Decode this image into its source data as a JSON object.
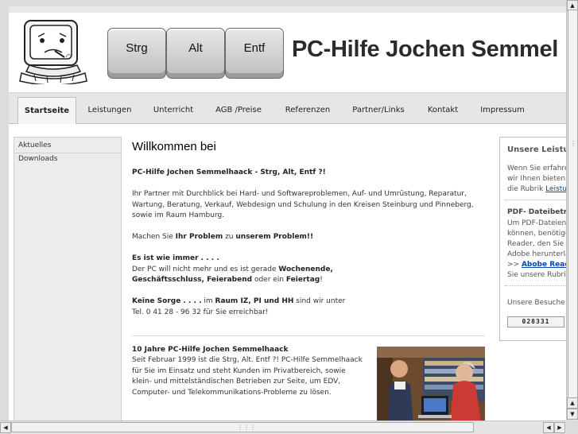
{
  "header": {
    "keys": [
      "Strg",
      "Alt",
      "Entf"
    ],
    "site_title": "PC-Hilfe Jochen Semmel"
  },
  "nav": {
    "tabs": [
      {
        "label": "Startseite",
        "active": true
      },
      {
        "label": "Leistungen"
      },
      {
        "label": "Unterricht"
      },
      {
        "label": "AGB /Preise"
      },
      {
        "label": "Referenzen"
      },
      {
        "label": "Partner/Links"
      },
      {
        "label": "Kontakt"
      },
      {
        "label": "Impressum"
      }
    ]
  },
  "sidebar": {
    "items": [
      {
        "label": "Aktuelles"
      },
      {
        "label": "Downloads"
      }
    ]
  },
  "main": {
    "heading": "Willkommen bei",
    "intro_bold": "PC-Hilfe Jochen Semmelhaack - Strg, Alt, Entf ?!",
    "para1": "Ihr Partner mit Durchblick bei Hard- und Softwareproblemen, Auf- und Umrüstung, Reparatur, Wartung, Beratung, Verkauf, Webdesign und Schulung in den Kreisen Steinburg und Pinneberg, sowie im Raum Hamburg.",
    "para2": {
      "a": "Machen Sie ",
      "b": "Ihr Problem",
      "c": " zu ",
      "d": "unserem Problem!!"
    },
    "para3": {
      "heading": "Es ist wie immer . . . .",
      "a": "Der PC will nicht mehr und es ist gerade ",
      "b": "Wochenende,",
      "c": "Geschäftsschluss, Feierabend",
      "d": " oder ein ",
      "e": "Feiertag",
      "f": "!"
    },
    "para4": {
      "a": "Keine Sorge . . . .",
      "b": "  im ",
      "c": "Raum IZ, PI und HH",
      "d": " sind wir unter",
      "e": "Tel. 0 41 28 - 96 32 für Sie erreichbar!"
    },
    "news": {
      "title": "10 Jahre PC-Hilfe Jochen Semmelhaack",
      "text": "Seit Februar 1999 ist die Strg, Alt. Entf ?! PC-Hilfe Semmelhaack für Sie im Einsatz und steht Kunden im Privatbereich, sowie klein- und mittelständischen Betrieben zur Seite, um EDV, Computer- und Telekommunikations-Probleme zu lösen."
    }
  },
  "rightbox": {
    "title": "Unsere Leistu",
    "lines1": [
      "Wenn Sie erfahre",
      "wir Ihnen bieten,",
      "die Rubrik "
    ],
    "link1": "Leistu",
    "pdf_title": "PDF- Dateibetra",
    "pdf_lines": [
      "Um PDF-Dateien",
      "können, benötige",
      "Reader, den Sie",
      "Adobe herunterla"
    ],
    "pdf_prefix": ">> ",
    "pdf_link": "Abobe Reade",
    "pdf_last": "Sie unsere Rubri",
    "visitors_label": "Unsere Besuche",
    "counter": "028331"
  },
  "colors": {
    "link": "#0645ad",
    "nav_bg": "#e6e6e6",
    "sidebar_bg": "#ececec"
  }
}
